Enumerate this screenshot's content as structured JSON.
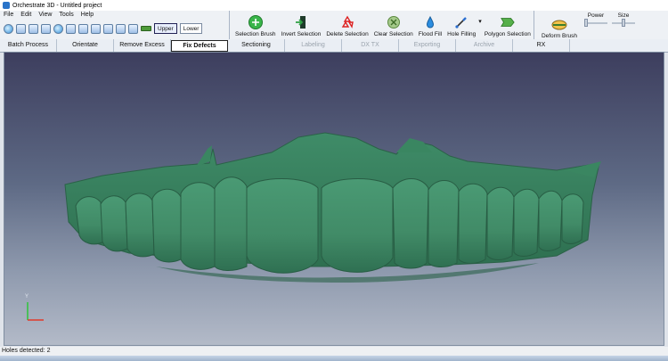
{
  "window": {
    "title": "Orchestrate 3D - Untitled project"
  },
  "menu": [
    "File",
    "Edit",
    "View",
    "Tools",
    "Help"
  ],
  "jaw": {
    "upper": "Upper",
    "lower": "Lower",
    "selected": "Upper"
  },
  "tools": [
    {
      "label": "Selection Brush",
      "icon": "selection-brush-icon"
    },
    {
      "label": "Invert Selection",
      "icon": "invert-selection-icon"
    },
    {
      "label": "Delete Selection",
      "icon": "delete-selection-icon"
    },
    {
      "label": "Clear Selection",
      "icon": "clear-selection-icon"
    },
    {
      "label": "Flood Fill",
      "icon": "flood-fill-icon"
    },
    {
      "label": "Hole Filling",
      "icon": "hole-filling-icon"
    },
    {
      "label": "Polygon Selection",
      "icon": "polygon-selection-icon"
    }
  ],
  "deform": {
    "label": "Deform Brush",
    "power_label": "Power",
    "size_label": "Size"
  },
  "tabs": [
    {
      "label": "Batch Process",
      "state": "normal"
    },
    {
      "label": "Orientate",
      "state": "normal"
    },
    {
      "label": "Remove Excess",
      "state": "normal"
    },
    {
      "label": "Fix Defects",
      "state": "active"
    },
    {
      "label": "Sectioning",
      "state": "normal"
    },
    {
      "label": "Labeling",
      "state": "disabled"
    },
    {
      "label": "DX TX",
      "state": "disabled"
    },
    {
      "label": "Exporting",
      "state": "disabled"
    },
    {
      "label": "Archive",
      "state": "disabled"
    },
    {
      "label": "RX",
      "state": "normal"
    }
  ],
  "viewport": {
    "axis_y": "Y"
  },
  "status": {
    "text": "Holes detected: 2"
  },
  "colors": {
    "model": "#3f8a66",
    "model_dark": "#2c6b4d",
    "active_tab_border": "#222222"
  }
}
